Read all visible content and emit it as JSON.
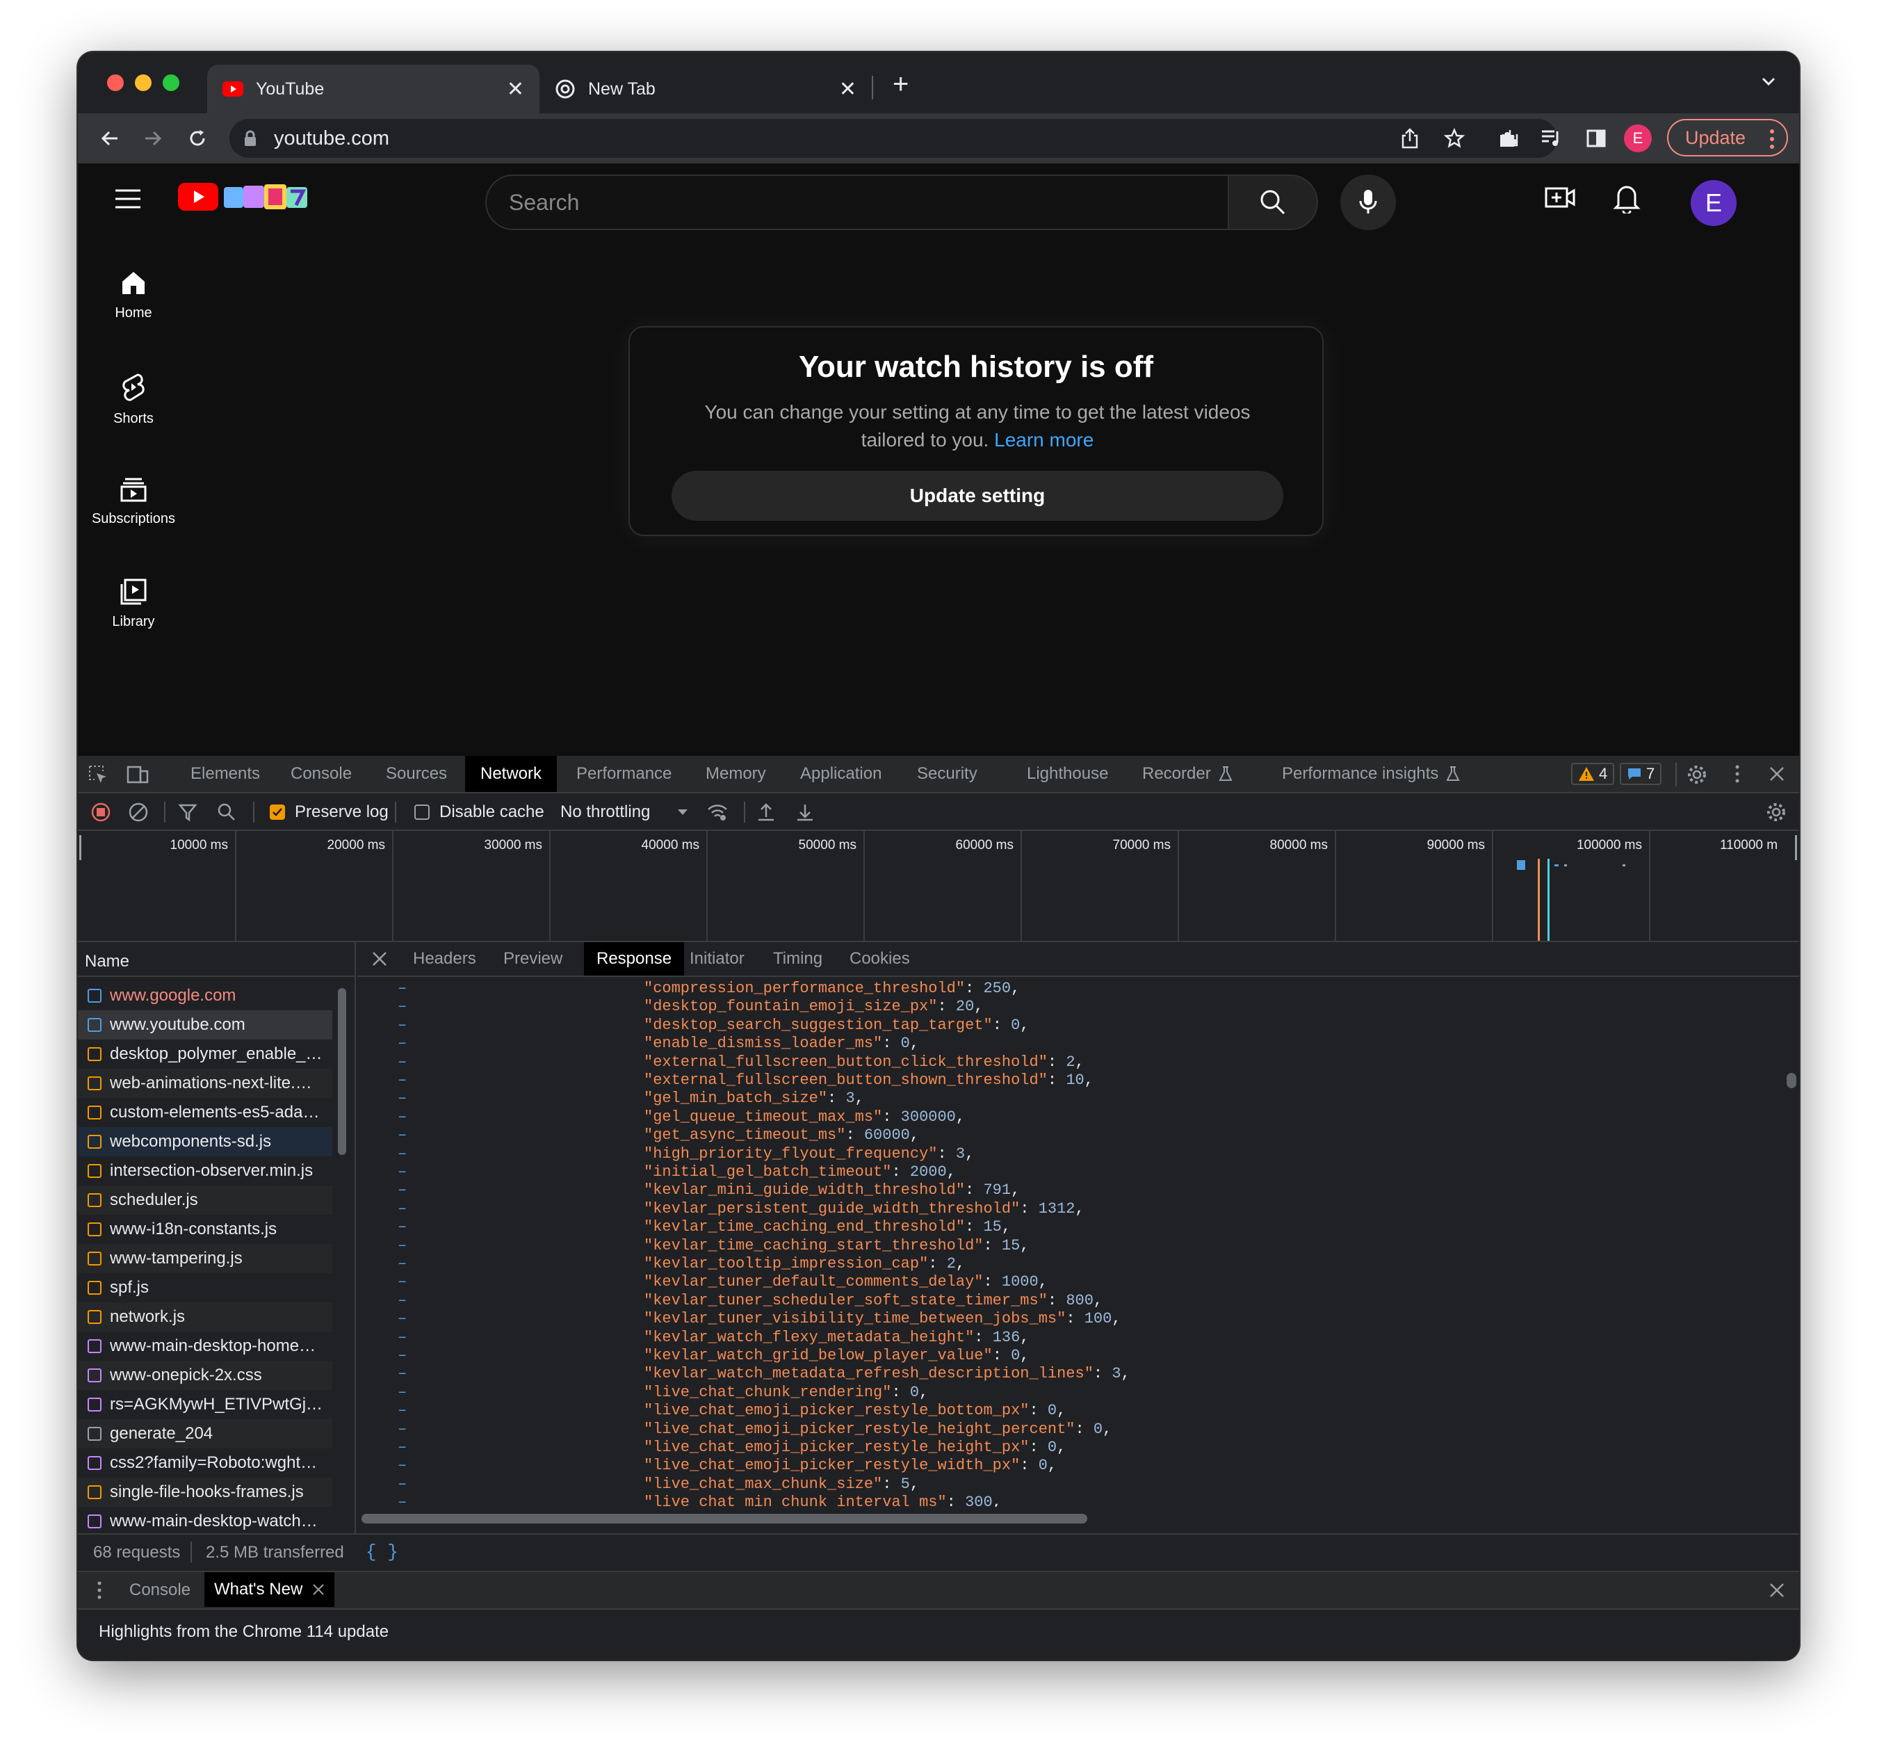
{
  "browser": {
    "tabs": [
      {
        "title": "YouTube",
        "icon": "youtube-favicon",
        "active": true
      },
      {
        "title": "New Tab",
        "icon": "chrome-icon",
        "active": false
      }
    ],
    "url": "youtube.com",
    "profile_initial": "E",
    "update_label": "Update"
  },
  "youtube": {
    "search_placeholder": "Search",
    "avatar_initial": "E",
    "guide": [
      {
        "label": "Home",
        "icon": "home-icon"
      },
      {
        "label": "Shorts",
        "icon": "shorts-icon"
      },
      {
        "label": "Subscriptions",
        "icon": "subscriptions-icon"
      },
      {
        "label": "Library",
        "icon": "library-icon"
      }
    ],
    "card": {
      "title": "Your watch history is off",
      "body": "You can change your setting at any time to get the latest videos tailored to you.",
      "link": "Learn more",
      "button": "Update setting"
    }
  },
  "devtools": {
    "tabs": [
      "Elements",
      "Console",
      "Sources",
      "Network",
      "Performance",
      "Memory",
      "Application",
      "Security",
      "Lighthouse",
      "Recorder",
      "Performance insights"
    ],
    "active_tab": "Network",
    "warnings": "4",
    "messages": "7",
    "toolbar": {
      "preserve_log": "Preserve log",
      "preserve_log_checked": true,
      "disable_cache": "Disable cache",
      "disable_cache_checked": false,
      "throttling": "No throttling"
    },
    "timeline_ticks": [
      "10000 ms",
      "20000 ms",
      "30000 ms",
      "40000 ms",
      "50000 ms",
      "60000 ms",
      "70000 ms",
      "80000 ms",
      "90000 ms",
      "100000 ms",
      "110000 m"
    ],
    "request_list_header": "Name",
    "requests": [
      {
        "name": "www.google.com",
        "type": "doc",
        "error": true
      },
      {
        "name": "www.youtube.com",
        "type": "doc",
        "selected": true
      },
      {
        "name": "desktop_polymer_enable_…",
        "type": "js"
      },
      {
        "name": "web-animations-next-lite.…",
        "type": "js"
      },
      {
        "name": "custom-elements-es5-ada…",
        "type": "js"
      },
      {
        "name": "webcomponents-sd.js",
        "type": "js",
        "highlight": true
      },
      {
        "name": "intersection-observer.min.js",
        "type": "js"
      },
      {
        "name": "scheduler.js",
        "type": "js"
      },
      {
        "name": "www-i18n-constants.js",
        "type": "js"
      },
      {
        "name": "www-tampering.js",
        "type": "js"
      },
      {
        "name": "spf.js",
        "type": "js"
      },
      {
        "name": "network.js",
        "type": "js"
      },
      {
        "name": "www-main-desktop-home…",
        "type": "css"
      },
      {
        "name": "www-onepick-2x.css",
        "type": "css"
      },
      {
        "name": "rs=AGKMywH_ETIVPwtGj…",
        "type": "css"
      },
      {
        "name": "generate_204",
        "type": "other"
      },
      {
        "name": "css2?family=Roboto:wght…",
        "type": "css"
      },
      {
        "name": "single-file-hooks-frames.js",
        "type": "js"
      },
      {
        "name": "www-main-desktop-watch…",
        "type": "css"
      }
    ],
    "detail_tabs": [
      "Headers",
      "Preview",
      "Response",
      "Initiator",
      "Timing",
      "Cookies"
    ],
    "active_detail_tab": "Response",
    "response_lines": [
      {
        "key": "\"compression_performance_threshold\"",
        "value": "250"
      },
      {
        "key": "\"desktop_fountain_emoji_size_px\"",
        "value": "20"
      },
      {
        "key": "\"desktop_search_suggestion_tap_target\"",
        "value": "0"
      },
      {
        "key": "\"enable_dismiss_loader_ms\"",
        "value": "0"
      },
      {
        "key": "\"external_fullscreen_button_click_threshold\"",
        "value": "2"
      },
      {
        "key": "\"external_fullscreen_button_shown_threshold\"",
        "value": "10"
      },
      {
        "key": "\"gel_min_batch_size\"",
        "value": "3"
      },
      {
        "key": "\"gel_queue_timeout_max_ms\"",
        "value": "300000"
      },
      {
        "key": "\"get_async_timeout_ms\"",
        "value": "60000"
      },
      {
        "key": "\"high_priority_flyout_frequency\"",
        "value": "3"
      },
      {
        "key": "\"initial_gel_batch_timeout\"",
        "value": "2000"
      },
      {
        "key": "\"kevlar_mini_guide_width_threshold\"",
        "value": "791"
      },
      {
        "key": "\"kevlar_persistent_guide_width_threshold\"",
        "value": "1312"
      },
      {
        "key": "\"kevlar_time_caching_end_threshold\"",
        "value": "15"
      },
      {
        "key": "\"kevlar_time_caching_start_threshold\"",
        "value": "15"
      },
      {
        "key": "\"kevlar_tooltip_impression_cap\"",
        "value": "2"
      },
      {
        "key": "\"kevlar_tuner_default_comments_delay\"",
        "value": "1000"
      },
      {
        "key": "\"kevlar_tuner_scheduler_soft_state_timer_ms\"",
        "value": "800"
      },
      {
        "key": "\"kevlar_tuner_visibility_time_between_jobs_ms\"",
        "value": "100"
      },
      {
        "key": "\"kevlar_watch_flexy_metadata_height\"",
        "value": "136"
      },
      {
        "key": "\"kevlar_watch_grid_below_player_value\"",
        "value": "0"
      },
      {
        "key": "\"kevlar_watch_metadata_refresh_description_lines\"",
        "value": "3"
      },
      {
        "key": "\"live_chat_chunk_rendering\"",
        "value": "0"
      },
      {
        "key": "\"live_chat_emoji_picker_restyle_bottom_px\"",
        "value": "0"
      },
      {
        "key": "\"live_chat_emoji_picker_restyle_height_percent\"",
        "value": "0"
      },
      {
        "key": "\"live_chat_emoji_picker_restyle_height_px\"",
        "value": "0"
      },
      {
        "key": "\"live_chat_emoji_picker_restyle_width_px\"",
        "value": "0"
      },
      {
        "key": "\"live_chat_max_chunk_size\"",
        "value": "5"
      },
      {
        "key": "\"live_chat_min_chunk_interval_ms\"",
        "value": "300"
      }
    ],
    "status": {
      "requests": "68 requests",
      "transferred": "2.5 MB transferred",
      "pretty_print": "{ }"
    },
    "drawer": {
      "tabs": [
        "Console",
        "What's New"
      ],
      "active": "What's New",
      "body": "Highlights from the Chrome 114 update"
    }
  },
  "colors": {
    "accent_red": "#ff0000",
    "link_blue": "#3ea6ff",
    "json_key": "#f28b54",
    "json_number": "#9bbbdc",
    "checkbox_orange": "#f29900"
  }
}
